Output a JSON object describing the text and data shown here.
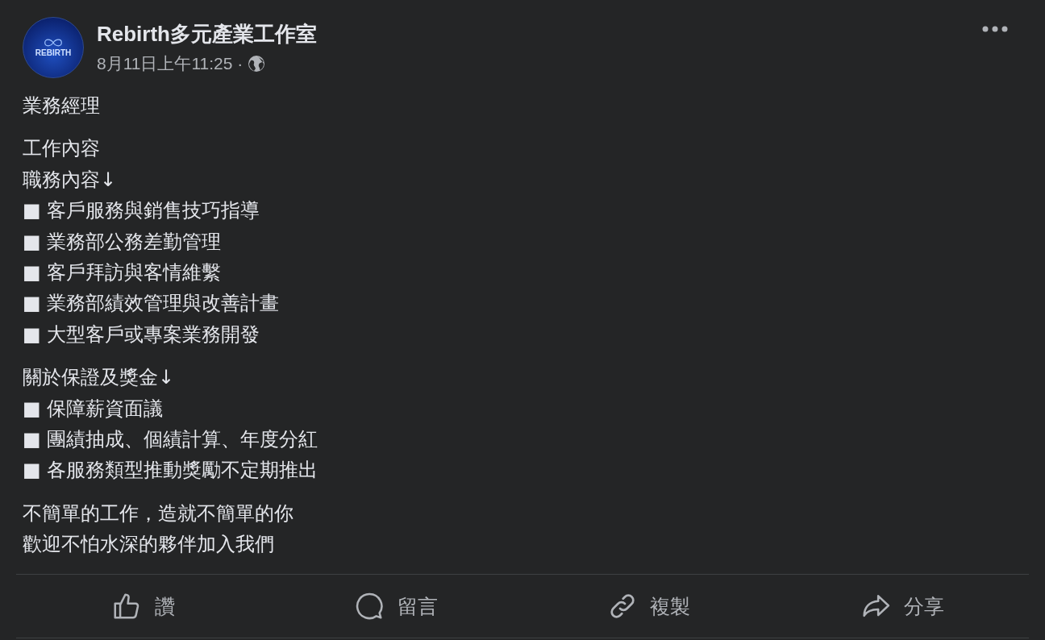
{
  "post": {
    "author": "Rebirth多元產業工作室",
    "avatar_text": "REBIRTH",
    "timestamp": "8月11日上午11:25 ·",
    "paragraphs": [
      [
        "業務經理"
      ],
      [
        "工作內容",
        "職務內容↓",
        "■ 客戶服務與銷售技巧指導",
        "■ 業務部公務差勤管理",
        "■ 客戶拜訪與客情維繫",
        "■ 業務部績效管理與改善計畫",
        "■ 大型客戶或專案業務開發"
      ],
      [
        "關於保證及獎金↓",
        "■ 保障薪資面議",
        "■ 團績抽成、個績計算、年度分紅",
        "■ 各服務類型推動獎勵不定期推出"
      ],
      [
        "不簡單的工作，造就不簡單的你",
        "歡迎不怕水深的夥伴加入我們"
      ]
    ],
    "actions": [
      {
        "kind": "like",
        "label": "讚"
      },
      {
        "kind": "comment",
        "label": "留言"
      },
      {
        "kind": "copy",
        "label": "複製"
      },
      {
        "kind": "share",
        "label": "分享"
      }
    ]
  }
}
